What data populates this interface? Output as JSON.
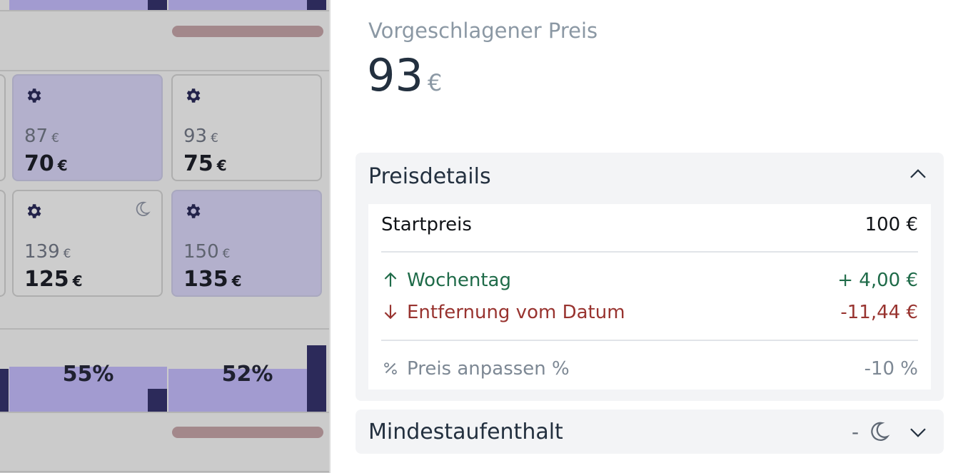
{
  "calendar": {
    "row1": [
      {
        "original_price": "87",
        "price": "70",
        "currency": "€",
        "selected": true,
        "has_moon": false
      },
      {
        "original_price": "93",
        "price": "75",
        "currency": "€",
        "selected": false,
        "has_moon": false
      }
    ],
    "row2": [
      {
        "original_price": "139",
        "price": "125",
        "currency": "€",
        "selected": false,
        "has_moon": true
      },
      {
        "original_price": "150",
        "price": "135",
        "currency": "€",
        "selected": true,
        "has_moon": false
      }
    ],
    "occupancy": [
      "55%",
      "52%"
    ]
  },
  "suggested": {
    "label": "Vorgeschlagener Preis",
    "price": "93",
    "currency": "€"
  },
  "price_details": {
    "title": "Preisdetails",
    "start_label": "Startpreis",
    "start_value": "100 €",
    "adjustments": [
      {
        "direction": "up",
        "label": "Wochentag",
        "value": "+ 4,00 €",
        "color": "#1f6b49"
      },
      {
        "direction": "down",
        "label": "Entfernung vom Datum",
        "value": "-11,44 €",
        "color": "#98332f"
      }
    ],
    "percent_label": "Preis anpassen %",
    "percent_value": "-10 %"
  },
  "min_stay": {
    "title": "Mindestaufenthalt",
    "value": "-"
  },
  "colors": {
    "accent_bar": "#a29bd0",
    "accent_dark": "#2c2a5a",
    "text_dark": "#23303f"
  }
}
